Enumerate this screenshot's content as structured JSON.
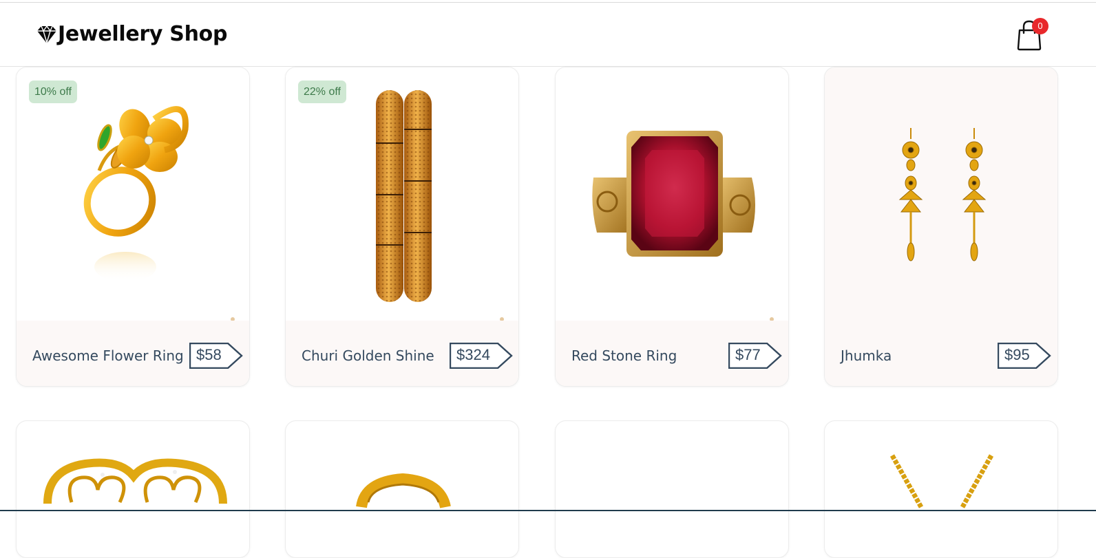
{
  "header": {
    "brand_title": "Jewellery Shop",
    "brand_icon": "diamond-icon",
    "cart_icon": "shopping-bag-icon",
    "cart_count": "0"
  },
  "products": [
    {
      "name": "Awesome Flower Ring",
      "price": "$58",
      "discount": "10% off",
      "image": "gold-flower-ring"
    },
    {
      "name": "Churi Golden Shine",
      "price": "$324",
      "discount": "22% off",
      "image": "gold-bangles"
    },
    {
      "name": "Red Stone Ring",
      "price": "$77",
      "discount": "",
      "image": "red-stone-ring"
    },
    {
      "name": "Jhumka",
      "price": "$95",
      "discount": "",
      "image": "gold-jhumka-earrings"
    },
    {
      "name": "",
      "price": "",
      "discount": "",
      "image": "gold-heart-ring"
    },
    {
      "name": "",
      "price": "",
      "discount": "",
      "image": "gold-band-ring"
    },
    {
      "name": "",
      "price": "",
      "discount": "",
      "image": ""
    },
    {
      "name": "",
      "price": "",
      "discount": "",
      "image": "gold-chain"
    }
  ],
  "colors": {
    "accent": "#34495e",
    "badge_bg": "#cfe8d3",
    "badge_text": "#3d7a4a",
    "cart_badge": "#e8282b",
    "footer_bg": "#fcf8f7"
  }
}
